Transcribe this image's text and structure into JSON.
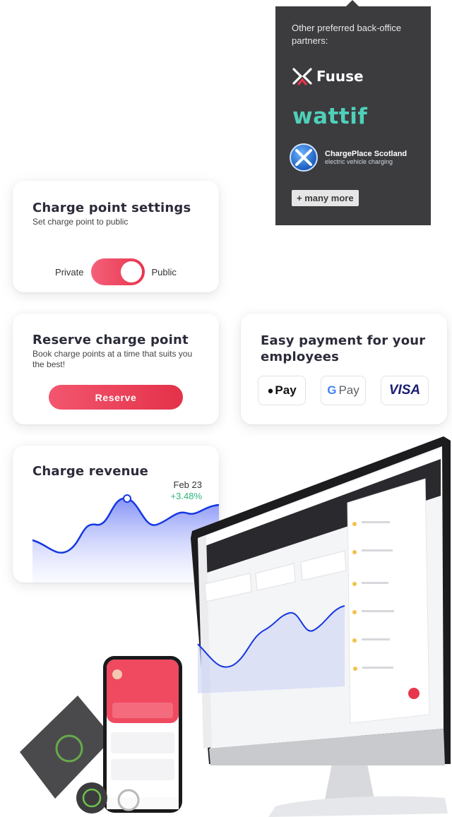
{
  "partners": {
    "intro": "Other preferred back-office partners:",
    "logos": [
      "Fuuse",
      "wattif",
      "ChargePlace Scotland"
    ],
    "fuuse_name": "Fuuse",
    "wattif_name": "wattif",
    "cps_name": "ChargePlace Scotland",
    "cps_tagline": "electric vehicle charging",
    "more_label": "+ many more"
  },
  "charge_settings": {
    "title": "Charge point settings",
    "subtitle": "Set charge point to public",
    "toggle_left": "Private",
    "toggle_right": "Public",
    "toggle_state": "Public"
  },
  "reserve": {
    "title": "Reserve charge point",
    "subtitle": "Book charge points at a time that suits you the best!",
    "button": "Reserve"
  },
  "payment": {
    "title": "Easy payment for your employees",
    "methods": [
      "Pay",
      "Pay",
      "VISA"
    ],
    "apple_label": "Pay",
    "google_label": "Pay",
    "visa_label": "VISA"
  },
  "revenue": {
    "title": "Charge revenue",
    "date": "Feb 23",
    "change": "+3.48%"
  },
  "colors": {
    "accent": "#e8364d",
    "panel": "#3c3c3f",
    "wattif": "#4fd0b9",
    "positive": "#2eb57c",
    "chart_line": "#1537e0"
  }
}
